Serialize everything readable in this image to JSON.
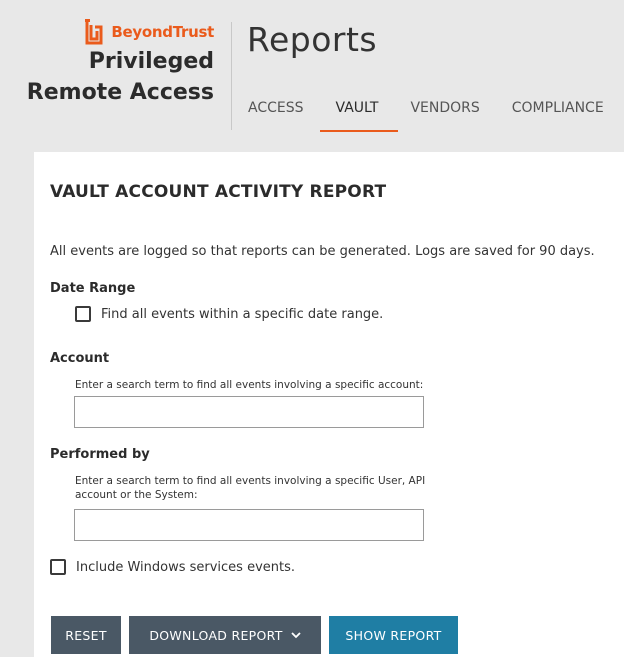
{
  "brand": {
    "company": "BeyondTrust",
    "product_line1": "Privileged",
    "product_line2": "Remote Access",
    "accent_color": "#ea5b1c",
    "logo_icon": "beyondtrust-logo-icon"
  },
  "header": {
    "title": "Reports"
  },
  "nav": {
    "tabs": [
      {
        "label": "ACCESS",
        "active": false
      },
      {
        "label": "VAULT",
        "active": true
      },
      {
        "label": "VENDORS",
        "active": false
      },
      {
        "label": "COMPLIANCE",
        "active": false
      }
    ]
  },
  "report": {
    "title": "VAULT ACCOUNT ACTIVITY REPORT",
    "intro": "All events are logged so that reports can be generated. Logs are saved for 90 days.",
    "date_range": {
      "label": "Date Range",
      "checkbox_label": "Find all events within a specific date range.",
      "checked": false
    },
    "account": {
      "label": "Account",
      "hint": "Enter a search term to find all events involving a specific account:",
      "value": "",
      "placeholder": ""
    },
    "performed_by": {
      "label": "Performed by",
      "hint": "Enter a search term to find all events involving a specific User, API account or the System:",
      "value": "",
      "placeholder": ""
    },
    "windows_services": {
      "checkbox_label": "Include Windows services events.",
      "checked": false
    }
  },
  "buttons": {
    "reset": "RESET",
    "download": "DOWNLOAD REPORT",
    "show": "SHOW REPORT",
    "download_icon": "chevron-down-icon",
    "dark_color": "#4a5865",
    "primary_color": "#1f7ea4"
  }
}
